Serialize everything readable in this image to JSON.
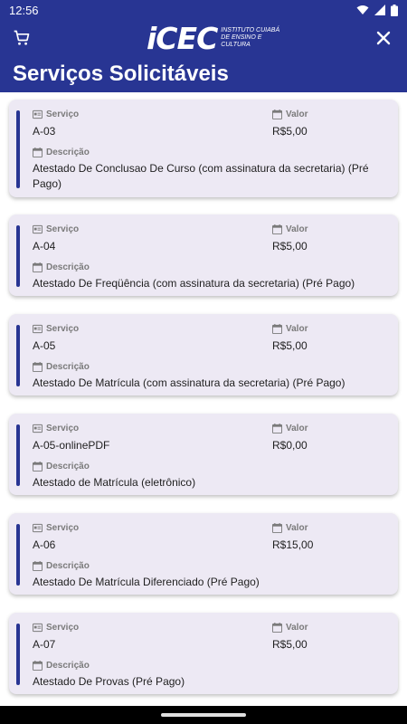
{
  "status": {
    "time": "12:56"
  },
  "header": {
    "logo_mark": "iCEC",
    "logo_text": "Instituto Cuiabá de Ensino e Cultura",
    "title": "Serviços Solicitáveis"
  },
  "labels": {
    "servico": "Serviço",
    "valor": "Valor",
    "descricao": "Descrição"
  },
  "services": [
    {
      "code": "A-03",
      "price": "R$5,00",
      "description": "Atestado De Conclusao De Curso (com assinatura da secretaria) (Pré Pago)"
    },
    {
      "code": "A-04",
      "price": "R$5,00",
      "description": "Atestado De Freqüência (com assinatura da secretaria) (Pré Pago)"
    },
    {
      "code": "A-05",
      "price": "R$5,00",
      "description": "Atestado De Matrícula (com assinatura da secretaria) (Pré Pago)"
    },
    {
      "code": "A-05-onlinePDF",
      "price": "R$0,00",
      "description": "Atestado de Matrícula (eletrônico)"
    },
    {
      "code": "A-06",
      "price": "R$15,00",
      "description": "Atestado De Matrícula Diferenciado (Pré Pago)"
    },
    {
      "code": "A-07",
      "price": "R$5,00",
      "description": "Atestado De Provas (Pré Pago)"
    }
  ]
}
